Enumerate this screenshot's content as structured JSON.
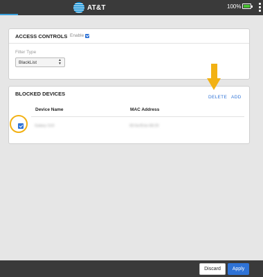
{
  "topbar": {
    "brand": "AT&T",
    "battery_text": "100%",
    "battery_icon": "battery-icon",
    "menu_icon": "more-vert-icon"
  },
  "access_controls": {
    "title": "ACCESS CONTROLS",
    "enable_label": "Enable",
    "enabled": true,
    "filter_type_label": "Filter Type",
    "filter_type_value": "BlackList"
  },
  "blocked_devices": {
    "title": "BLOCKED DEVICES",
    "delete_label": "DELETE",
    "add_label": "ADD",
    "columns": [
      "Device Name",
      "MAC Address"
    ],
    "rows": [
      {
        "checked": true,
        "device_name": "Galaxy S10",
        "mac_address": "00:0a:f5:bc:68:20"
      }
    ]
  },
  "footer": {
    "discard_label": "Discard",
    "apply_label": "Apply"
  },
  "colors": {
    "accent": "#2f73d6",
    "highlight": "#f2b114",
    "bar": "#3a3a3a"
  }
}
